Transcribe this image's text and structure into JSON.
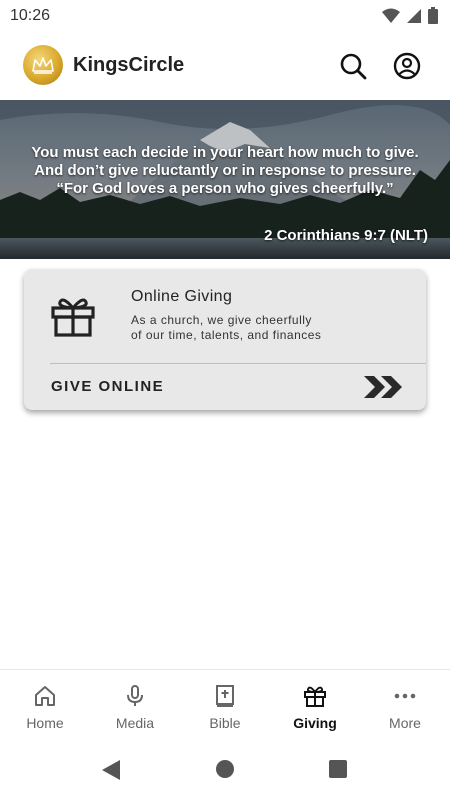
{
  "status": {
    "time": "10:26"
  },
  "appbar": {
    "title": "KingsCircle"
  },
  "banner": {
    "quote_lines": [
      "You must each decide in your heart how much to give.",
      "And don’t give reluctantly or in response to pressure.",
      "“For God loves a person who gives cheerfully.”"
    ],
    "reference": "2 Corinthians 9:7 (NLT)"
  },
  "card": {
    "title": "Online Giving",
    "description_lines": [
      "As a church, we give cheerfully",
      "of our time, talents, and finances"
    ],
    "action_label": "GIVE ONLINE"
  },
  "bottom_nav": [
    {
      "label": "Home",
      "icon": "home-icon",
      "active": false
    },
    {
      "label": "Media",
      "icon": "microphone-icon",
      "active": false
    },
    {
      "label": "Bible",
      "icon": "bible-icon",
      "active": false
    },
    {
      "label": "Giving",
      "icon": "gift-icon",
      "active": true
    },
    {
      "label": "More",
      "icon": "more-icon",
      "active": false
    }
  ],
  "colors": {
    "brand_gold": "#d9a92c",
    "card_bg": "#e8e8e8",
    "text_dark": "#222222"
  }
}
